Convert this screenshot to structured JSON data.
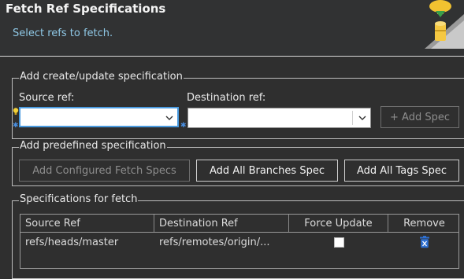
{
  "header": {
    "title": "Fetch Ref Specifications",
    "subtitle": "Select refs to fetch."
  },
  "add_group": {
    "title": "Add create/update specification",
    "source_label": "Source ref:",
    "destination_label": "Destination ref:",
    "source_value": "",
    "destination_value": "",
    "add_spec_label": "+ Add Spec"
  },
  "predefined_group": {
    "title": "Add predefined specification",
    "configured_label": "Add Configured Fetch Specs",
    "all_branches_label": "Add All Branches Spec",
    "all_tags_label": "Add All Tags Spec"
  },
  "specs_group": {
    "title": "Specifications for fetch",
    "columns": [
      "Source Ref",
      "Destination Ref",
      "Force Update",
      "Remove"
    ],
    "rows": [
      {
        "source": "refs/heads/master",
        "destination": "refs/remotes/origin/...",
        "force_update": false
      }
    ]
  },
  "colors": {
    "background": "#2f2f2f",
    "subtitle": "#8fc8e6",
    "focus": "#4a9be0",
    "remove_icon": "#2d6fd1"
  }
}
